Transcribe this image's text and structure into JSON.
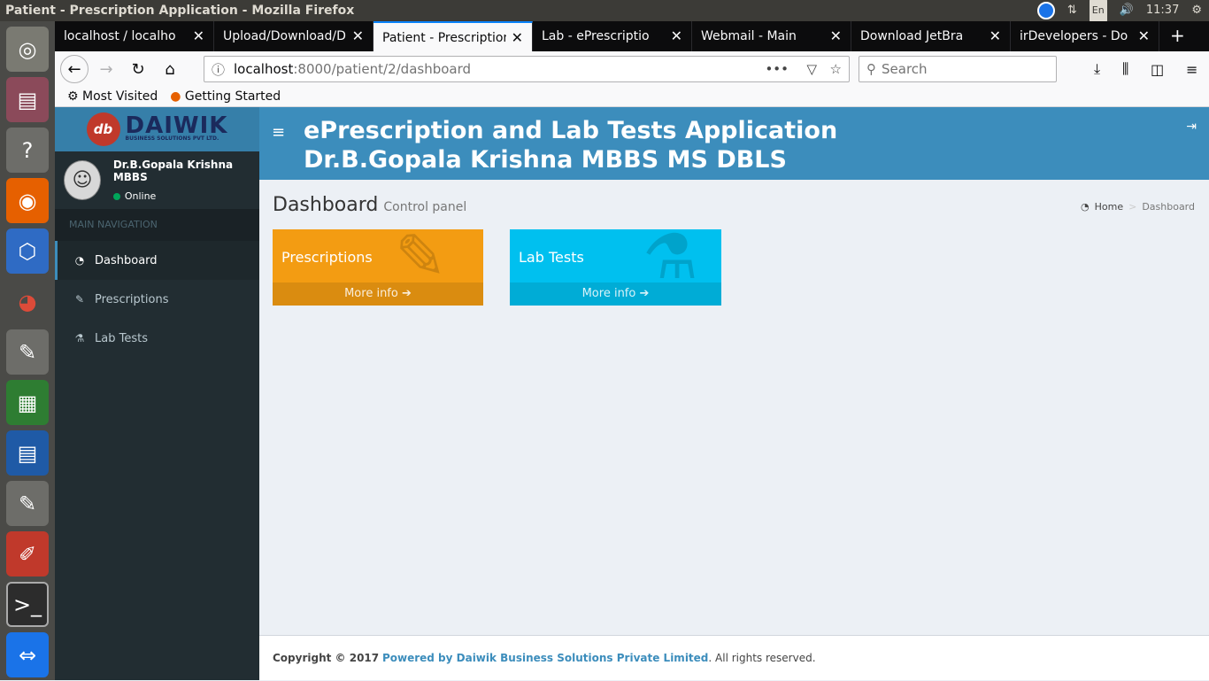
{
  "window": {
    "title": "Patient - Prescription Application - Mozilla Firefox",
    "time": "11:37",
    "lang": "En"
  },
  "launcher": {
    "icons": [
      "ubuntu-icon",
      "files-icon",
      "help-icon",
      "firefox-icon",
      "box-icon",
      "chrome-icon",
      "text-editor-icon",
      "spreadsheet-icon",
      "document-icon",
      "text-editor-icon",
      "paint-icon",
      "terminal-icon",
      "teamviewer-icon"
    ]
  },
  "tabs": [
    {
      "label": "localhost / localho"
    },
    {
      "label": "Upload/Download/D"
    },
    {
      "label": "Patient - Prescription"
    },
    {
      "label": "Lab - ePrescriptio"
    },
    {
      "label": "Webmail - Main"
    },
    {
      "label": "Download JetBra"
    },
    {
      "label": "irDevelopers - Do"
    }
  ],
  "address": {
    "host": "localhost",
    "path": ":8000/patient/2/dashboard",
    "search_placeholder": "Search"
  },
  "bookmarks": {
    "most_visited": "Most Visited",
    "getting_started": "Getting Started"
  },
  "brand": {
    "name": "DAIWIK",
    "sub": "BUSINESS SOLUTIONS PVT LTD.",
    "mark": "db"
  },
  "user": {
    "name": "Dr.B.Gopala Krishna MBBS",
    "status": "Online"
  },
  "nav": {
    "header": "MAIN NAVIGATION",
    "items": [
      {
        "label": "Dashboard"
      },
      {
        "label": "Prescriptions"
      },
      {
        "label": "Lab Tests"
      }
    ]
  },
  "header": {
    "line1": "ePrescription and Lab Tests Application",
    "line2": "Dr.B.Gopala Krishna MBBS MS DBLS"
  },
  "page": {
    "title": "Dashboard",
    "subtitle": "Control panel",
    "breadcrumb_home": "Home",
    "breadcrumb_current": "Dashboard"
  },
  "boxes": [
    {
      "title": "Prescriptions",
      "more": "More info",
      "color": "#f39c12"
    },
    {
      "title": "Lab Tests",
      "more": "More info",
      "color": "#00c0ef"
    }
  ],
  "footer": {
    "copyright": "Copyright © 2017",
    "powered": "Powered by Daiwik Business Solutions Private Limited",
    "rights": ". All rights reserved."
  },
  "colors": {
    "header": "#3c8dbc",
    "sidebar": "#222d32",
    "accent": "#3c8dbc"
  }
}
